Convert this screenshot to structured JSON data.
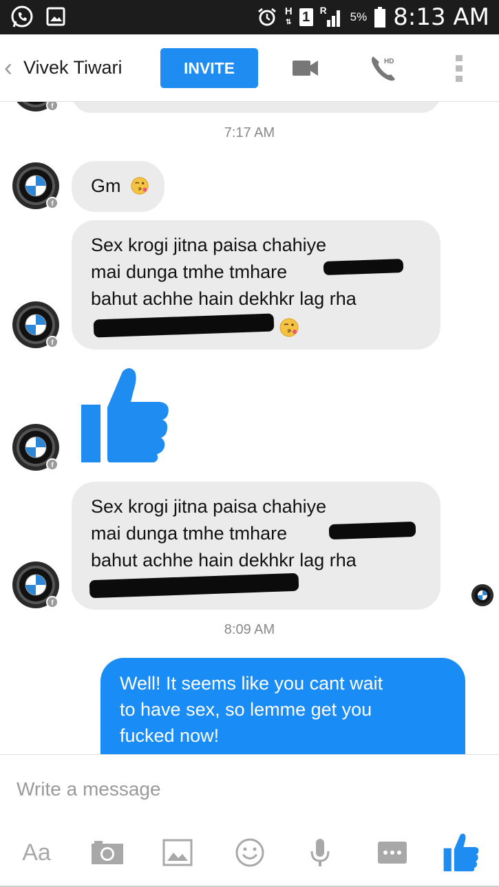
{
  "status_bar": {
    "time": "8:13 AM",
    "battery_percent": "5%",
    "network_h": "H",
    "sim_slot": "1",
    "roaming": "R",
    "icons": [
      "whatsapp-icon",
      "gallery-notification-icon",
      "alarm-icon",
      "signal-icon",
      "battery-icon"
    ]
  },
  "header": {
    "contact_name": "Vivek Tiwari",
    "invite_label": "INVITE",
    "hd_label": "HD",
    "icons": [
      "back-chevron-icon",
      "video-camera-icon",
      "phone-hd-icon",
      "overflow-menu-icon"
    ]
  },
  "messages": {
    "timestamp_1": "7:17 AM",
    "msg_gm": "Gm",
    "msg_1_lines": [
      "Sex krogi jitna paisa chahiye",
      "mai dunga tmhe tmhare",
      "bahut achhe hain dekhkr lag rha",
      ""
    ],
    "msg_2_lines": [
      "Sex krogi jitna paisa chahiye",
      "mai dunga tmhe tmhare",
      "bahut achhe hain dekhkr lag rha",
      ""
    ],
    "timestamp_2": "8:09 AM",
    "reply_lines": [
      "Well! It seems like you cant wait",
      "to have sex, so lemme get you",
      "fucked now!"
    ]
  },
  "composer": {
    "placeholder": "Write a message",
    "text_format_label": "Aa",
    "icons": [
      "camera-icon",
      "gallery-icon",
      "emoji-icon",
      "microphone-icon",
      "more-icon",
      "thumbs-up-icon"
    ]
  },
  "colors": {
    "accent": "#1e8cf0",
    "incoming_bubble": "#ebebeb",
    "status_bar": "#1c1c1c"
  }
}
